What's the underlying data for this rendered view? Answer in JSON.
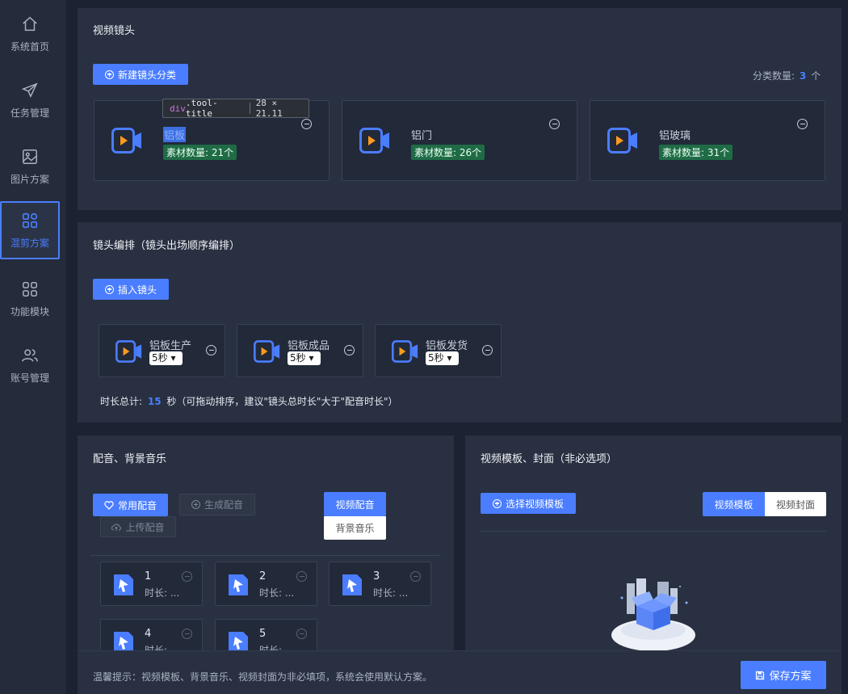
{
  "sidebar": {
    "items": [
      {
        "label": "系统首页",
        "icon": "home-icon"
      },
      {
        "label": "任务管理",
        "icon": "send-icon"
      },
      {
        "label": "图片方案",
        "icon": "image-icon"
      },
      {
        "label": "混剪方案",
        "icon": "grid-icon",
        "active": true
      },
      {
        "label": "功能模块",
        "icon": "apps-icon"
      },
      {
        "label": "账号管理",
        "icon": "users-icon"
      }
    ]
  },
  "shots_section": {
    "title": "视频镜头",
    "new_category_button": "新建镜头分类",
    "count_label": "分类数量:",
    "count_value": "3",
    "count_unit": "个",
    "categories": [
      {
        "name": "铝板",
        "badge": "素材数量: 21个"
      },
      {
        "name": "铝门",
        "badge": "素材数量: 26个"
      },
      {
        "name": "铝玻璃",
        "badge": "素材数量: 31个"
      }
    ],
    "tooltip": {
      "tag": "div",
      "cls": ".tool-title",
      "size": "28 × 21.11"
    }
  },
  "arrange_section": {
    "title": "镜头编排（镜头出场顺序编排）",
    "insert_button": "插入镜头",
    "shots": [
      {
        "name": "铝板生产",
        "duration": "5秒"
      },
      {
        "name": "铝板成品",
        "duration": "5秒"
      },
      {
        "name": "铝板发货",
        "duration": "5秒"
      }
    ],
    "total_label": "时长总计:",
    "total_value": "15",
    "total_suffix": "秒（可拖动排序，建议\"镜头总时长\"大于\"配音时长\"）"
  },
  "audio_section": {
    "title": "配音、背景音乐",
    "common_button": "常用配音",
    "generate_button": "生成配音",
    "upload_button": "上传配音",
    "tab_voice": "视频配音",
    "tab_music": "背景音乐",
    "items": [
      {
        "num": "1",
        "dur": "时长: ..."
      },
      {
        "num": "2",
        "dur": "时长: ..."
      },
      {
        "num": "3",
        "dur": "时长: ..."
      },
      {
        "num": "4",
        "dur": "时长:"
      },
      {
        "num": "5",
        "dur": "时长:"
      }
    ]
  },
  "template_section": {
    "title": "视频模板、封面（非必选项）",
    "select_button": "选择视频模板",
    "tab_template": "视频模板",
    "tab_cover": "视频封面"
  },
  "footer": {
    "tip": "温馨提示：视频模板、背景音乐、视频封面为非必填项，系统会使用默认方案。",
    "save_button": "保存方案"
  },
  "colors": {
    "accent": "#4a7dff",
    "badge_green": "#1f6b46",
    "camera_orange": "#ff9a1f"
  }
}
